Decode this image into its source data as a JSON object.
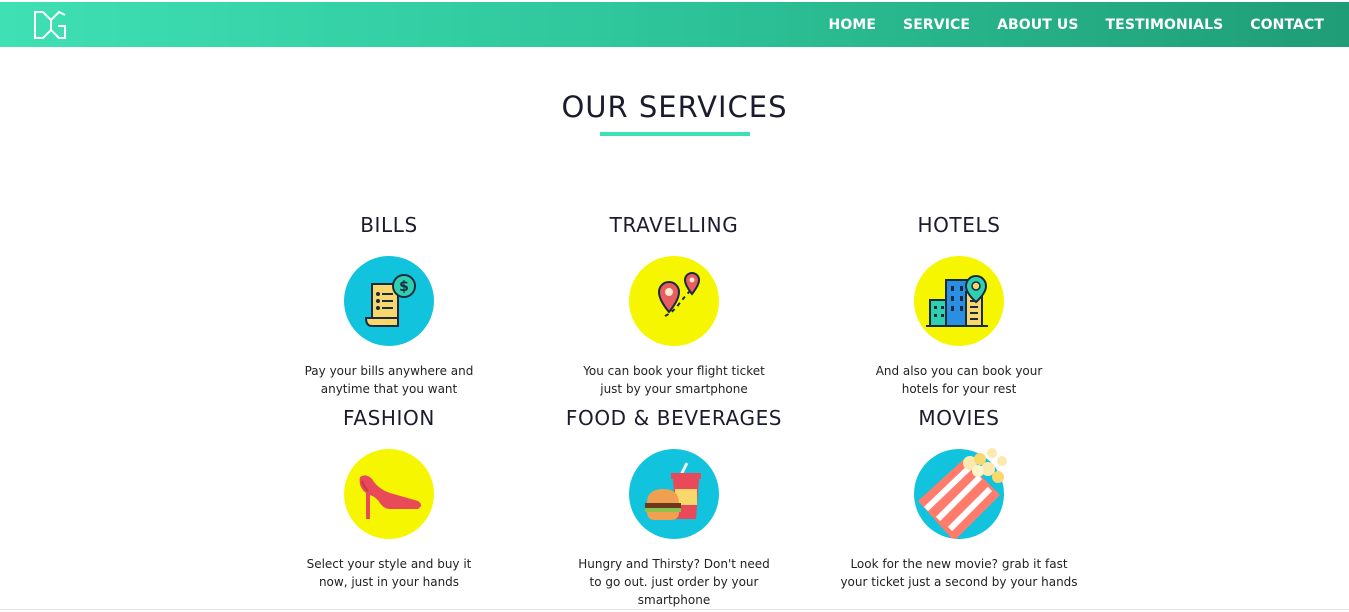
{
  "nav": {
    "logo_text": "DG",
    "links": [
      "HOME",
      "SERVICE",
      "ABOUT US",
      "TESTIMONIALS",
      "CONTACT"
    ]
  },
  "section": {
    "title": "OUR SERVICES"
  },
  "services": [
    {
      "title": "BILLS",
      "icon": "bill-receipt-icon",
      "circle_color": "#12c3dd",
      "line1": "Pay your bills anywhere and",
      "line2": "anytime that you want"
    },
    {
      "title": "TRAVELLING",
      "icon": "map-pin-route-icon",
      "circle_color": "#f6f600",
      "line1": "You can book your flight ticket",
      "line2": "just by your smartphone"
    },
    {
      "title": "HOTELS",
      "icon": "hotel-building-icon",
      "circle_color": "#f6f600",
      "line1": "And also you can book your",
      "line2": "hotels for your rest"
    },
    {
      "title": "FASHION",
      "icon": "high-heel-icon",
      "circle_color": "#f6f600",
      "line1": "Select your style and buy it",
      "line2": "now, just in your hands"
    },
    {
      "title": "FOOD & BEVERAGES",
      "icon": "burger-drink-icon",
      "circle_color": "#12c3dd",
      "line1": "Hungry and Thirsty? Don't need",
      "line2": "to go out. just order by your smartphone"
    },
    {
      "title": "MOVIES",
      "icon": "popcorn-icon",
      "circle_color": "#12c3dd",
      "line1": "Look for the new movie? grab it fast",
      "line2": "your ticket just a second by your hands"
    }
  ],
  "colors": {
    "accent": "#3fe0b4",
    "nav_dark": "#1f9d76",
    "cyan": "#12c3dd",
    "yellow": "#f6f600"
  }
}
